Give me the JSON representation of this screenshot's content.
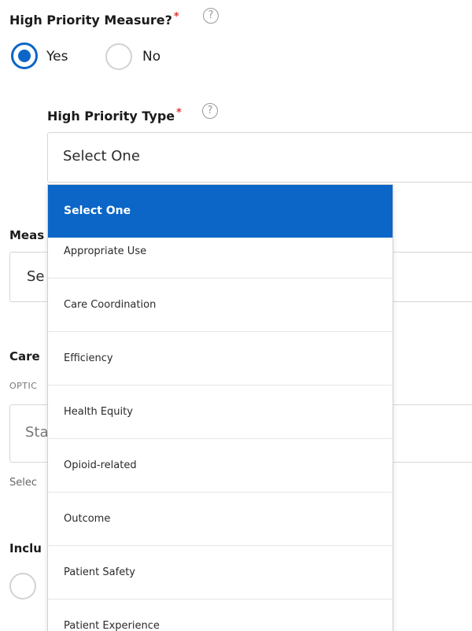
{
  "high_priority_measure": {
    "label": "High Priority Measure?",
    "required_mark": "*",
    "help_icon": "question-circle-icon",
    "options": [
      {
        "label": "Yes",
        "checked": true
      },
      {
        "label": "No",
        "checked": false
      }
    ]
  },
  "high_priority_type": {
    "label": "High Priority Type",
    "required_mark": "*",
    "help_icon": "question-circle-icon",
    "selected_value": "Select One",
    "dropdown_options": [
      "Select One",
      "Appropriate Use",
      "Care Coordination",
      "Efficiency",
      "Health Equity",
      "Opioid-related",
      "Outcome",
      "Patient Safety",
      "Patient Experience"
    ]
  },
  "background_partial_text": {
    "measure_label": "Meas",
    "measure_select": "Se",
    "care_label": "Care",
    "optional_text": "OPTIC",
    "start_input": "Sta",
    "select_hint": "Selec",
    "include_label": "Inclu"
  },
  "colors": {
    "accent": "#0b66c7",
    "required": "#d83933"
  }
}
